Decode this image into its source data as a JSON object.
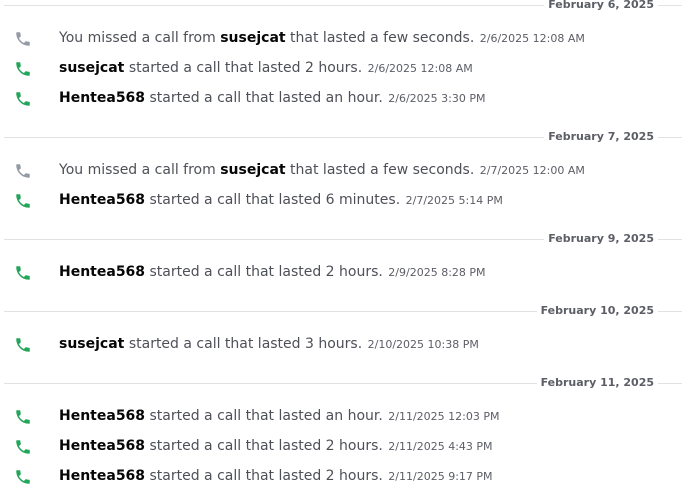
{
  "colors": {
    "call_icon": "#23a55a",
    "missed_icon": "#949ba4",
    "divider": "#e1e2e4",
    "username": "#060607",
    "text": "#4e5058",
    "timestamp": "#5c5e66"
  },
  "icons": {
    "call": "phone-icon",
    "missed": "phone-missed-icon"
  },
  "groups": [
    {
      "date": "February 6, 2025",
      "entries": [
        {
          "kind": "missed",
          "prefix": "You missed a call from ",
          "user": "susejcat",
          "suffix": " that lasted a few seconds.",
          "timestamp": "2/6/2025 12:08 AM"
        },
        {
          "kind": "call",
          "prefix": "",
          "user": "susejcat",
          "suffix": " started a call that lasted 2 hours.",
          "timestamp": "2/6/2025 12:08 AM"
        },
        {
          "kind": "call",
          "prefix": "",
          "user": "Hentea568",
          "suffix": " started a call that lasted an hour.",
          "timestamp": "2/6/2025 3:30 PM"
        }
      ]
    },
    {
      "date": "February 7, 2025",
      "entries": [
        {
          "kind": "missed",
          "prefix": "You missed a call from ",
          "user": "susejcat",
          "suffix": " that lasted a few seconds.",
          "timestamp": "2/7/2025 12:00 AM"
        },
        {
          "kind": "call",
          "prefix": "",
          "user": "Hentea568",
          "suffix": " started a call that lasted 6 minutes.",
          "timestamp": "2/7/2025 5:14 PM"
        }
      ]
    },
    {
      "date": "February 9, 2025",
      "entries": [
        {
          "kind": "call",
          "prefix": "",
          "user": "Hentea568",
          "suffix": " started a call that lasted 2 hours.",
          "timestamp": "2/9/2025 8:28 PM"
        }
      ]
    },
    {
      "date": "February 10, 2025",
      "entries": [
        {
          "kind": "call",
          "prefix": "",
          "user": "susejcat",
          "suffix": " started a call that lasted 3 hours.",
          "timestamp": "2/10/2025 10:38 PM"
        }
      ]
    },
    {
      "date": "February 11, 2025",
      "entries": [
        {
          "kind": "call",
          "prefix": "",
          "user": "Hentea568",
          "suffix": " started a call that lasted an hour.",
          "timestamp": "2/11/2025 12:03 PM"
        },
        {
          "kind": "call",
          "prefix": "",
          "user": "Hentea568",
          "suffix": " started a call that lasted 2 hours.",
          "timestamp": "2/11/2025 4:43 PM"
        },
        {
          "kind": "call",
          "prefix": "",
          "user": "Hentea568",
          "suffix": " started a call that lasted 2 hours.",
          "timestamp": "2/11/2025 9:17 PM"
        }
      ]
    }
  ]
}
